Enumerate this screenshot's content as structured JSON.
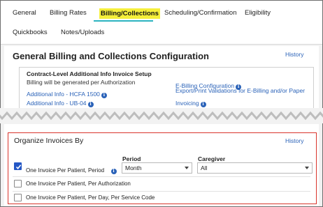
{
  "tabs": [
    {
      "label": "General"
    },
    {
      "label": "Billing Rates"
    },
    {
      "label": "Billing/Collections",
      "active": true
    },
    {
      "label": "Scheduling/Confirmation"
    },
    {
      "label": "Eligibility"
    },
    {
      "label": "Quickbooks"
    },
    {
      "label": "Notes/Uploads"
    }
  ],
  "config": {
    "title": "General Billing and Collections Configuration",
    "history_label": "History",
    "setup": {
      "title": "Contract-Level Additional Info Invoice Setup",
      "billing_text": "Billing will be generated per Authorization",
      "hcfa_link": "Additional Info - HCFA 1500",
      "ub04_link": "Additional Info - UB-04",
      "ebilling_link": "E-Billing Configuration",
      "export_line1": "Export/Print Validations for E-Billing and/or Paper",
      "export_line2": "Invoicing"
    }
  },
  "organize": {
    "title": "Organize Invoices By",
    "history_label": "History",
    "period_label": "Period",
    "period_value": "Month",
    "caregiver_label": "Caregiver",
    "caregiver_value": "All",
    "options": [
      {
        "label": "One Invoice Per Patient, Period",
        "checked": true
      },
      {
        "label": "One Invoice Per Patient, Per Authorization",
        "checked": false
      },
      {
        "label": "One Invoice Per Patient, Per Day, Per Service Code",
        "checked": false
      }
    ]
  },
  "colors": {
    "active_tab_highlight": "#f5ef3a",
    "active_tab_underline": "#2bb3c0",
    "link": "#2a62b8",
    "checked": "#2457c5",
    "highlight_border": "#d9342b"
  }
}
